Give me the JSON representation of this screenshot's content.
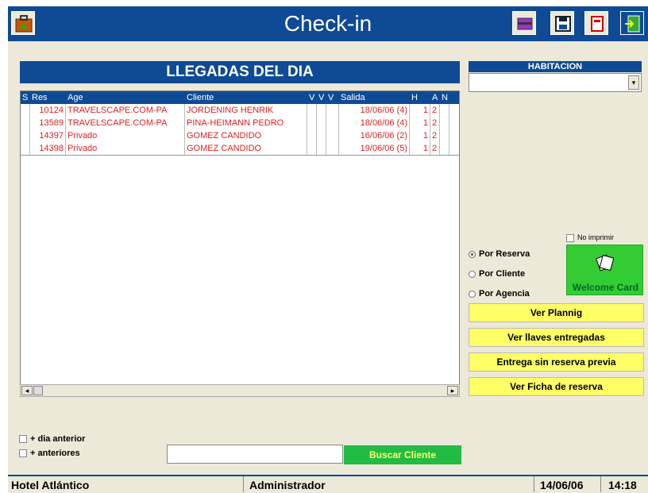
{
  "window": {
    "title": "Check-in"
  },
  "toolbar": {
    "left_icon": "bag-icon",
    "right_icons": [
      "card-printer-icon",
      "save-disk-icon",
      "document-icon",
      "exit-door-icon"
    ]
  },
  "arrivals": {
    "title": "LLEGADAS DEL DIA",
    "columns": [
      "S",
      "Res",
      "Age",
      "Cliente",
      "V",
      "V",
      "V",
      "Salida",
      "H",
      "A",
      "N"
    ],
    "rows": [
      {
        "res": "10124",
        "age": "TRAVELSCAPE.COM-PA",
        "cliente": "JORDENING  HENRIK",
        "salida": "18/06/06 (4)",
        "h": "1",
        "a": "2"
      },
      {
        "res": "13589",
        "age": "TRAVELSCAPE.COM-PA",
        "cliente": "PINA-HEIMANN  PEDRO",
        "salida": "18/06/06 (4)",
        "h": "1",
        "a": "2"
      },
      {
        "res": "14397",
        "age": "Privado",
        "cliente": "GOMEZ  CANDIDO",
        "salida": "16/06/06 (2)",
        "h": "1",
        "a": "2"
      },
      {
        "res": "14398",
        "age": "Privado",
        "cliente": "GOMEZ  CANDIDO",
        "salida": "19/06/06 (5)",
        "h": "1",
        "a": "2"
      }
    ]
  },
  "habitacion": {
    "title": "HABITACION",
    "value": ""
  },
  "print": {
    "no_imprimir": "No imprimir"
  },
  "sort": {
    "options": [
      "Por Reserva",
      "Por Cliente",
      "Por Agencia"
    ],
    "selected": "Por Reserva"
  },
  "welcome_card": {
    "label": "Welcome Card"
  },
  "actions": {
    "ver_plannig": "Ver Plannig",
    "ver_llaves": "Ver llaves entregadas",
    "entrega": "Entrega sin reserva previa",
    "ver_ficha": "Ver Ficha de reserva"
  },
  "filters": {
    "dia_anterior": "+ dia anterior",
    "anteriores": "+ anteriores"
  },
  "search": {
    "value": "",
    "button": "Buscar Cliente"
  },
  "status": {
    "hotel": "Hotel Atlántico",
    "user": "Administrador",
    "date": "14/06/06",
    "time": "14:18"
  },
  "colors": {
    "title_blue": "#0f4a94",
    "button_yellow": "#ffff66",
    "button_green": "#22bb44",
    "row_red": "#dd2222"
  }
}
